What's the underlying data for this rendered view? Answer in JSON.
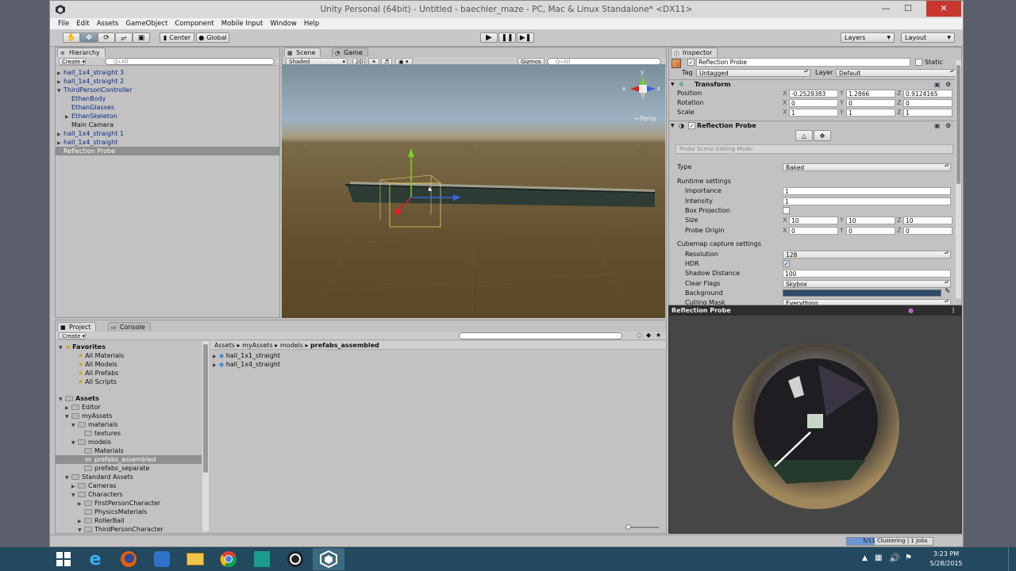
{
  "window": {
    "title": "Unity Personal (64bit) - Untitled - baechler_maze - PC, Mac & Linux Standalone* <DX11>",
    "minimize": "—",
    "maximize": "☐",
    "close": "✕"
  },
  "menu": [
    "File",
    "Edit",
    "Assets",
    "GameObject",
    "Component",
    "Mobile Input",
    "Window",
    "Help"
  ],
  "toolbar": {
    "center": "Center",
    "global": "Global",
    "layers": "Layers",
    "layout": "Layout"
  },
  "hierarchy": {
    "tab": "Hierarchy",
    "create": "Create",
    "search": "Q∙All",
    "items": [
      {
        "label": "hall_1x4_straight 3"
      },
      {
        "label": "hall_1x4_straight 2"
      },
      {
        "label": "ThirdPersonController"
      },
      {
        "label": "EthanBody"
      },
      {
        "label": "EthanGlasses"
      },
      {
        "label": "EthanSkeleton"
      },
      {
        "label": "Main Camera"
      },
      {
        "label": "hall_1x4_straight 1"
      },
      {
        "label": "hall_1x4_straight"
      },
      {
        "label": "Reflection Probe"
      }
    ]
  },
  "scene": {
    "tab_scene": "Scene",
    "tab_game": "Game",
    "shaded": "Shaded",
    "mode2d": "2D",
    "gizmos": "Gizmos",
    "search": "Q∙All",
    "persp": "←Persp",
    "axis_y": "y",
    "axis_x": "x",
    "axis_z": "z"
  },
  "inspector": {
    "tab": "Inspector",
    "object_name": "Reflection Probe",
    "static": "Static",
    "tag_label": "Tag",
    "tag_value": "Untagged",
    "layer_label": "Layer",
    "layer_value": "Default",
    "transform": {
      "title": "Transform",
      "position_label": "Position",
      "rotation_label": "Rotation",
      "scale_label": "Scale",
      "position": [
        "-0.2529383",
        "1.2866",
        "0.9124165"
      ],
      "rotation": [
        "0",
        "0",
        "0"
      ],
      "scale": [
        "1",
        "1",
        "1"
      ]
    },
    "probe": {
      "title": "Reflection Probe",
      "editing_mode": "Probe Scene Editing Mode:",
      "type_label": "Type",
      "type_value": "Baked",
      "runtime": "Runtime settings",
      "importance_label": "Importance",
      "importance": "1",
      "intensity_label": "Intensity",
      "intensity": "1",
      "box_projection": "Box Projection",
      "size_label": "Size",
      "size": [
        "10",
        "10",
        "10"
      ],
      "origin_label": "Probe Origin",
      "origin": [
        "0",
        "0",
        "0"
      ],
      "cubemap": "Cubemap capture settings",
      "resolution_label": "Resolution",
      "resolution": "128",
      "hdr_label": "HDR",
      "shadow_label": "Shadow Distance",
      "shadow": "100",
      "clear_label": "Clear Flags",
      "clear": "Skybox",
      "background_label": "Background",
      "culling_label": "Culling Mask",
      "culling": "Everything"
    },
    "preview_title": "Reflection Probe"
  },
  "project": {
    "tab_project": "Project",
    "tab_console": "Console",
    "create": "Create",
    "breadcrumb": [
      "Assets",
      "myAssets",
      "models",
      "prefabs_assembled"
    ],
    "assets": [
      "hall_1x1_straight",
      "hall_1x4_straight"
    ],
    "tree": [
      {
        "label": "Favorites"
      },
      {
        "label": "All Materials"
      },
      {
        "label": "All Models"
      },
      {
        "label": "All Prefabs"
      },
      {
        "label": "All Scripts"
      },
      {
        "label": "Assets"
      },
      {
        "label": "Editor"
      },
      {
        "label": "myAssets"
      },
      {
        "label": "materials"
      },
      {
        "label": "textures"
      },
      {
        "label": "models"
      },
      {
        "label": "Materials"
      },
      {
        "label": "prefabs_assembled"
      },
      {
        "label": "prefabs_separate"
      },
      {
        "label": "Standard Assets"
      },
      {
        "label": "Cameras"
      },
      {
        "label": "Characters"
      },
      {
        "label": "FirstPersonCharacter"
      },
      {
        "label": "PhysicsMaterials"
      },
      {
        "label": "RollerBall"
      },
      {
        "label": "ThirdPersonCharacter"
      }
    ]
  },
  "status": {
    "progress": "5/11 Clustering | 1 Jobs",
    "progress_fraction": 0.32
  },
  "taskbar": {
    "time": "3:23 PM",
    "date": "5/28/2015"
  },
  "colors": {
    "accent": "#3d6e9e",
    "taskbar": "#23495e",
    "close": "#c7372f"
  }
}
